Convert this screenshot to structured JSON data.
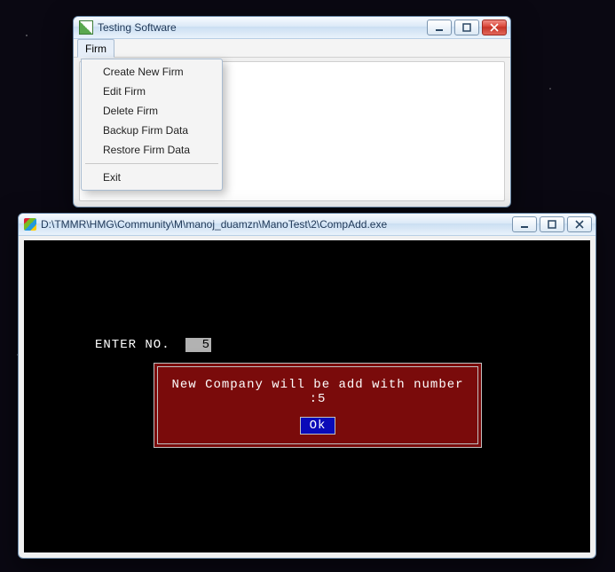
{
  "win1": {
    "title": "Testing Software",
    "menubar": {
      "firm": "Firm"
    },
    "menu": {
      "create": "Create New Firm",
      "edit": "Edit Firm",
      "delete": "Delete Firm",
      "backup": "Backup Firm Data",
      "restore": "Restore Firm Data",
      "exit": "Exit"
    }
  },
  "win2": {
    "title": "D:\\TMMR\\HMG\\Community\\M\\manoj_duamzn\\ManoTest\\2\\CompAdd.exe",
    "prompt": "ENTER NO.",
    "input_value": "5",
    "dialog_msg": "New Company will be add with number :5",
    "ok_label": "Ok"
  }
}
